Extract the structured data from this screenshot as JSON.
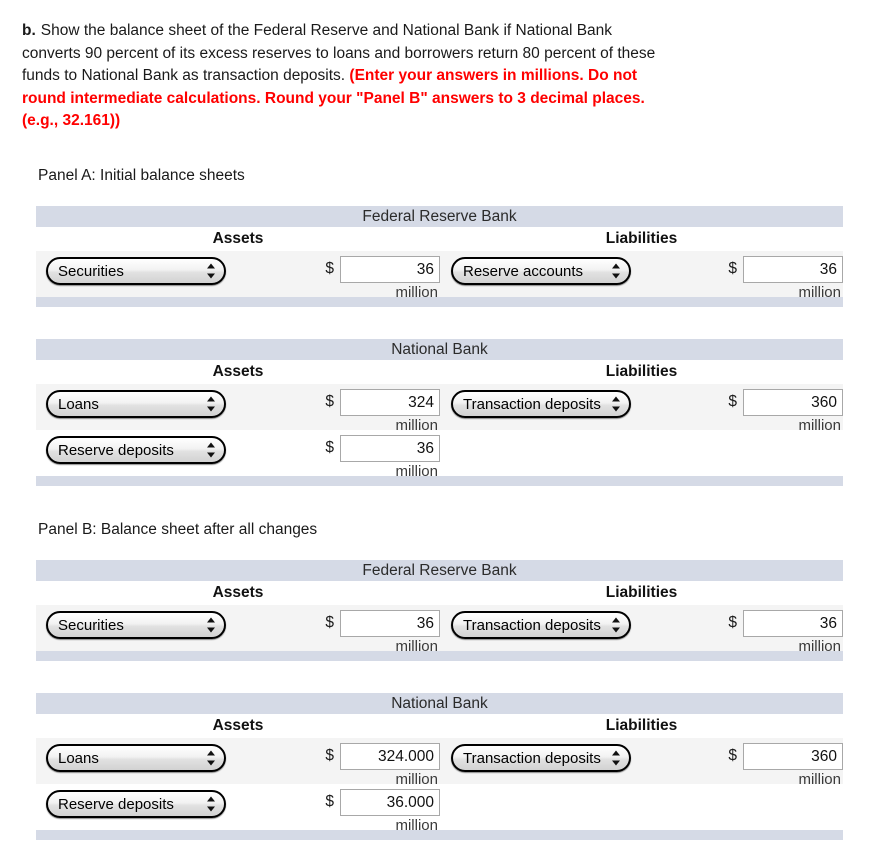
{
  "question": {
    "label": "b.",
    "text_black": "Show the balance sheet of the Federal Reserve and National Bank if National Bank converts 90 percent of its excess reserves to loans and borrowers return 80 percent of these funds to National Bank as transaction deposits.",
    "text_red": "(Enter your answers in millions. Do not round intermediate calculations. Round your \"Panel B\" answers to 3 decimal places. (e.g., 32.161))",
    "red_color": "#ff0000"
  },
  "panels": [
    {
      "heading": "Panel A: Initial balance sheets",
      "tables": [
        {
          "bank_title": "Federal Reserve Bank",
          "assets_header": "Assets",
          "liabilities_header": "Liabilities",
          "rows": [
            {
              "asset_account": "Securities",
              "asset_currency": "$",
              "asset_value": "36",
              "asset_unit": "million",
              "liab_account": "Reserve accounts",
              "liab_currency": "$",
              "liab_value": "36",
              "liab_unit": "million"
            }
          ]
        },
        {
          "bank_title": "National Bank",
          "assets_header": "Assets",
          "liabilities_header": "Liabilities",
          "rows": [
            {
              "asset_account": "Loans",
              "asset_currency": "$",
              "asset_value": "324",
              "asset_unit": "million",
              "liab_account": "Transaction deposits",
              "liab_currency": "$",
              "liab_value": "360",
              "liab_unit": "million"
            },
            {
              "asset_account": "Reserve deposits",
              "asset_currency": "$",
              "asset_value": "36",
              "asset_unit": "million",
              "liab_account": "",
              "liab_currency": "",
              "liab_value": "",
              "liab_unit": ""
            }
          ]
        }
      ]
    },
    {
      "heading": "Panel B: Balance sheet after all changes",
      "tables": [
        {
          "bank_title": "Federal Reserve Bank",
          "assets_header": "Assets",
          "liabilities_header": "Liabilities",
          "rows": [
            {
              "asset_account": "Securities",
              "asset_currency": "$",
              "asset_value": "36",
              "asset_unit": "million",
              "liab_account": "Transaction deposits",
              "liab_currency": "$",
              "liab_value": "36",
              "liab_unit": "million"
            }
          ]
        },
        {
          "bank_title": "National Bank",
          "assets_header": "Assets",
          "liabilities_header": "Liabilities",
          "rows": [
            {
              "asset_account": "Loans",
              "asset_currency": "$",
              "asset_value": "324.000",
              "asset_unit": "million",
              "liab_account": "Transaction deposits",
              "liab_currency": "$",
              "liab_value": "360",
              "liab_unit": "million"
            },
            {
              "asset_account": "Reserve deposits",
              "asset_currency": "$",
              "asset_value": "36.000",
              "asset_unit": "million",
              "liab_account": "",
              "liab_currency": "",
              "liab_value": "",
              "liab_unit": ""
            }
          ]
        }
      ]
    }
  ],
  "theme": {
    "band_color": "#d5dae6",
    "stripe_color": "#f4f4f4",
    "page_bg": "#ffffff"
  }
}
